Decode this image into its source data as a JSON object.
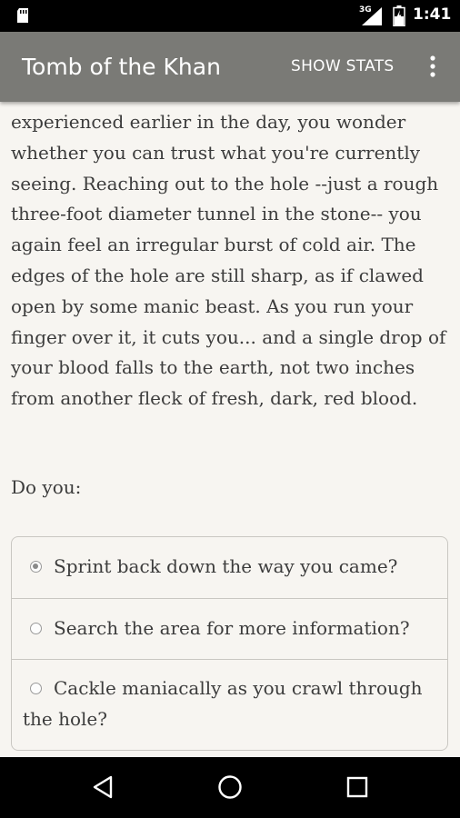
{
  "status_bar": {
    "network_type": "3G",
    "time": "1:41"
  },
  "app_bar": {
    "title": "Tomb of the Khan",
    "show_stats_label": "SHOW STATS"
  },
  "story": {
    "text": "experienced earlier in the day, you wonder whether you can trust what you're currently seeing. Reaching out to the hole --just a rough three-foot diameter tunnel in the stone-- you again feel an irregular burst of cold air. The edges of the hole are still sharp, as if clawed open by some manic beast. As you run your finger over it, it cuts you... and a single drop of your blood falls to the earth, not two inches from another fleck of fresh, dark, red blood.",
    "prompt": "Do you:"
  },
  "choices": [
    {
      "label": "Sprint back down the way you came?",
      "selected": true
    },
    {
      "label": "Search the area for more information?",
      "selected": false
    },
    {
      "label": "Cackle maniacally as you crawl through the hole?",
      "selected": false
    }
  ],
  "icons": {
    "status": [
      "sd-card-icon",
      "signal-icon",
      "battery-icon"
    ],
    "app_bar": [
      "overflow-menu-icon"
    ],
    "nav": [
      "back-icon",
      "home-icon",
      "recents-icon"
    ]
  },
  "colors": {
    "app_bar": "#7a7a76",
    "background": "#f7f5f1",
    "text": "#3c3c3c"
  }
}
